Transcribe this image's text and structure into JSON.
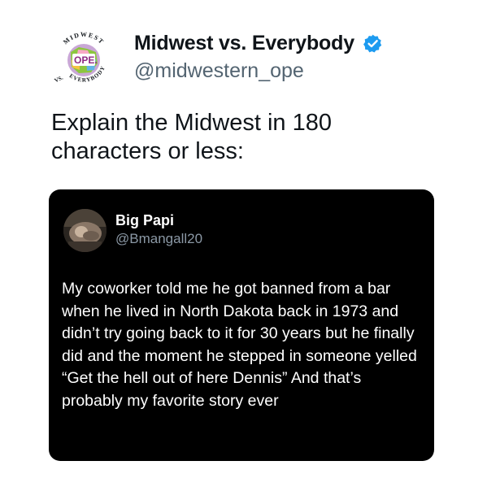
{
  "colors": {
    "background": "#ffffff",
    "text_primary": "#0f1419",
    "text_secondary": "#536471",
    "verified_blue": "#1d9bf0",
    "card_background": "#000000",
    "card_text": "#ffffff",
    "card_text_secondary": "#8b98a5"
  },
  "tweet": {
    "author": {
      "display_name": "Midwest vs. Everybody",
      "handle": "@midwestern_ope",
      "verified_icon": "verified-badge-icon",
      "avatar_icon": "midwest-logo-icon",
      "avatar_text": {
        "top_arc": "MIDWEST",
        "center": "OPE.",
        "bottom_arc": "EVERYBODY",
        "vs": "VS."
      }
    },
    "text": "Explain the Midwest in 180 characters or less:"
  },
  "quoted_tweet": {
    "author": {
      "display_name": "Big Papi",
      "handle": "@Bmangall20",
      "avatar_icon": "profile-photo-icon"
    },
    "text": "My coworker told me he got banned from a bar when he lived in North Dakota back in 1973 and didn’t try going back to it for 30 years but he finally did and the moment he stepped in someone yelled “Get the hell out of here Dennis” And that’s probably my favorite story ever"
  }
}
